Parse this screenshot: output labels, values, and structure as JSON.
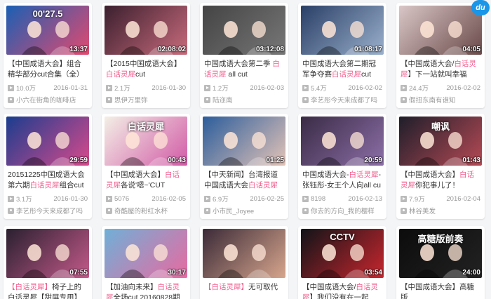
{
  "logo": "du",
  "cards": [
    {
      "duration": "13:37",
      "title_prefix": "【中国成语大会】",
      "title_hl": "",
      "title_rest": "组合精华部分cut合集（全）",
      "plays": "10.0万",
      "date": "2016-01-31",
      "uploader": "小六在街角的咖啡店",
      "palette": "#1a5fb4",
      "accent": "#e34a6f",
      "overlay": "00'27.5"
    },
    {
      "duration": "02:08:02",
      "title_prefix": "【2015中国成语大会】",
      "title_hl": "白话灵犀",
      "title_rest": "cut",
      "plays": "2.1万",
      "date": "2016-01-30",
      "uploader": "思伊万里弥",
      "palette": "#3b1f2e",
      "accent": "#c86b7c",
      "overlay": ""
    },
    {
      "duration": "03:12:08",
      "title_prefix": "中国成语大会第二季 ",
      "title_hl": "白话灵犀",
      "title_rest": " all cut",
      "plays": "1.2万",
      "date": "2016-02-03",
      "uploader": "陆迩南",
      "palette": "#444444",
      "accent": "#777777",
      "overlay": ""
    },
    {
      "duration": "01:08:17",
      "title_prefix": "中国成语大会第二期冠军争夺赛",
      "title_hl": "白话灵犀",
      "title_rest": "cut",
      "plays": "5.4万",
      "date": "2016-02-02",
      "uploader": "李艺彤今天来成都了吗",
      "palette": "#2a3f66",
      "accent": "#9ab0cc",
      "overlay": ""
    },
    {
      "duration": "04:05",
      "title_prefix": "【中国成语大会/",
      "title_hl": "白话灵犀",
      "title_rest": "】下一站就叫幸福（张钰纬&",
      "plays": "24.4万",
      "date": "2016-02-02",
      "uploader": "假扭东南有谁知",
      "palette": "#d9c6c6",
      "accent": "#6b4a4a",
      "overlay": ""
    },
    {
      "duration": "29:59",
      "title_prefix": "20151225中国成语大会第六期",
      "title_hl": "白话灵犀",
      "title_rest": "组合cut",
      "plays": "3.1万",
      "date": "2016-01-30",
      "uploader": "李艺彤今天来成都了吗",
      "palette": "#1a3d8f",
      "accent": "#d94a8c",
      "overlay": ""
    },
    {
      "duration": "00:43",
      "title_prefix": "【中国成语大会】",
      "title_hl": "白话灵犀",
      "title_rest": "各说'嗯~'CUT",
      "plays": "5076",
      "date": "2016-02-05",
      "uploader": "奇酷屋的粉红水杯",
      "palette": "#f3efe6",
      "accent": "#d25aa6",
      "overlay": "白话灵犀"
    },
    {
      "duration": "01:25",
      "title_prefix": "【中天新闻】台湾报道中国成语大会",
      "title_hl": "白话灵犀",
      "title_rest": "组合cut",
      "plays": "6.9万",
      "date": "2016-02-25",
      "uploader": "小市民_Joyee",
      "palette": "#2b5d9c",
      "accent": "#e3c3b7",
      "overlay": ""
    },
    {
      "duration": "20:59",
      "title_prefix": "中国成语大会-",
      "title_hl": "白话灵犀",
      "title_rest": "-张钰彤-女王个人向all cut",
      "plays": "8198",
      "date": "2016-02-13",
      "uploader": "你去的方向_我的樱样",
      "palette": "#3a2b45",
      "accent": "#8c6fa8",
      "overlay": ""
    },
    {
      "duration": "01:43",
      "title_prefix": "【中国成语大会】",
      "title_hl": "白话灵犀",
      "title_rest": "你犯事儿了！",
      "plays": "7.9万",
      "date": "2016-02-04",
      "uploader": "林谷美发",
      "palette": "#1e1e2a",
      "accent": "#b54a55",
      "overlay": "嘲讽"
    },
    {
      "duration": "07:55",
      "title_prefix": "",
      "title_hl": "【白话灵犀】",
      "title_rest": "椅子上的白话灵犀【甜屏专用】（中国成",
      "plays": "",
      "date": "",
      "uploader": "",
      "palette": "#2a2030",
      "accent": "#c45a8a",
      "overlay": ""
    },
    {
      "duration": "30:17",
      "title_prefix": "【加油向未来】",
      "title_hl": "白话灵犀",
      "title_rest": "全场cut 20160828期",
      "plays": "",
      "date": "",
      "uploader": "",
      "palette": "#6fb0d8",
      "accent": "#e86aa0",
      "overlay": ""
    },
    {
      "duration": "",
      "title_prefix": "",
      "title_hl": "【白话灵犀】",
      "title_rest": "无可取代",
      "plays": "",
      "date": "",
      "uploader": "",
      "palette": "#3b2a38",
      "accent": "#d6a58c",
      "overlay": ""
    },
    {
      "duration": "03:54",
      "title_prefix": "【中国成语大会/",
      "title_hl": "白话灵犀",
      "title_rest": "】我们没有在一起",
      "plays": "",
      "date": "",
      "uploader": "",
      "palette": "#101418",
      "accent": "#c8262e",
      "overlay": "CCTV"
    },
    {
      "duration": "24:00",
      "title_prefix": "【中国成语大会】",
      "title_hl": "",
      "title_rest": "高糖版",
      "plays": "",
      "date": "",
      "uploader": "",
      "palette": "#0c0c0c",
      "accent": "#222222",
      "overlay": "高糖版前奏"
    }
  ]
}
